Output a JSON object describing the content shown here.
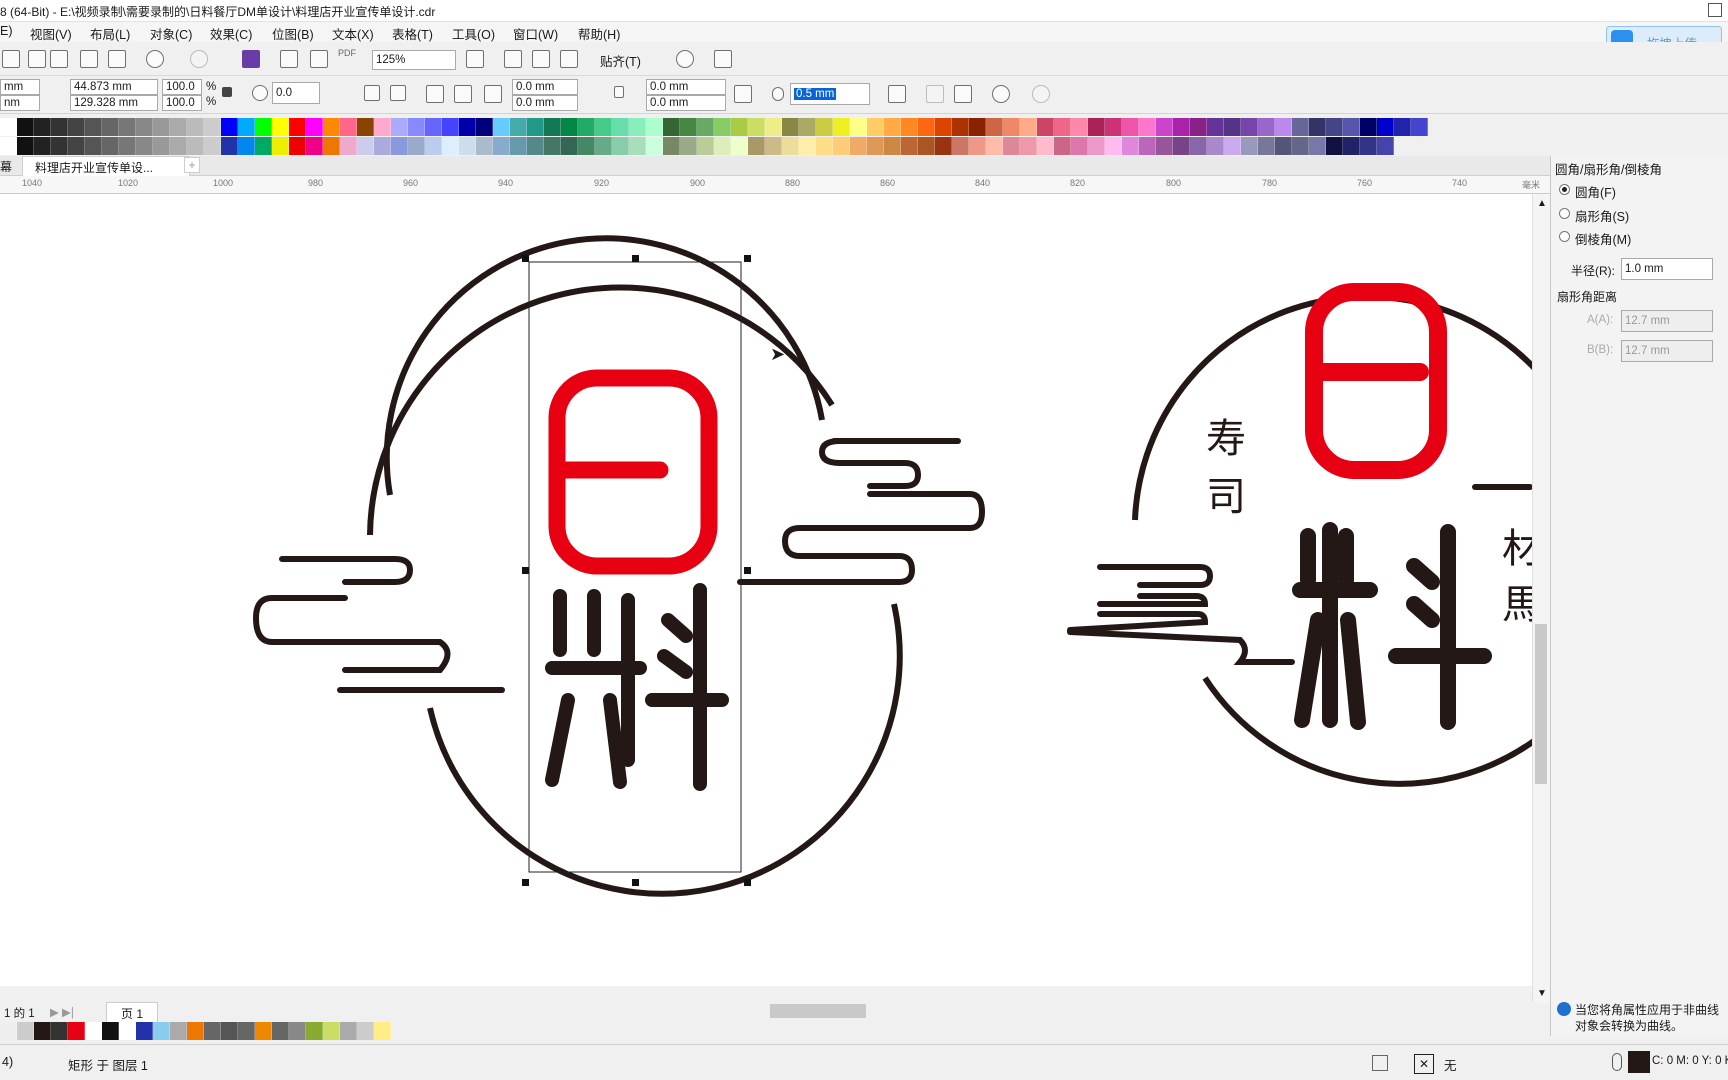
{
  "window": {
    "title": "8 (64-Bit) - E:\\视频录制\\需要录制的\\日料餐厅DM单设计\\料理店开业宣传单设计.cdr",
    "upload_button": "拖拽上传"
  },
  "menu": [
    "E)",
    "视图(V)",
    "布局(L)",
    "对象(C)",
    "效果(C)",
    "位图(B)",
    "文本(X)",
    "表格(T)",
    "工具(O)",
    "窗口(W)",
    "帮助(H)"
  ],
  "toolbar1": {
    "zoom": "125%",
    "snap_label": "贴齐(T)",
    "pdf_label": "PDF"
  },
  "toolbar2": {
    "pos_x": "mm",
    "pos_y": "nm",
    "width": "44.873 mm",
    "height": "129.328 mm",
    "scale_w": "100.0",
    "scale_h": "100.0",
    "pct": "%",
    "rotation": "0.0",
    "corner1": "0.0 mm",
    "corner2": "0.0 mm",
    "corner3": "0.0 mm",
    "corner4": "0.0 mm",
    "outline_width": "0.5 mm"
  },
  "tabs": {
    "first": "幕",
    "document": "料理店开业宣传单设...",
    "add": "+"
  },
  "ruler": {
    "ticks": [
      "1040",
      "1020",
      "1000",
      "980",
      "960",
      "940",
      "920",
      "900",
      "880",
      "860",
      "840",
      "820",
      "800",
      "780",
      "760",
      "740"
    ],
    "unit": "毫米"
  },
  "canvas": {
    "logo_char_main": "料",
    "logo_side_top": "寿",
    "logo_side_bottom": "司",
    "logo_right_top": "材",
    "logo_right_bottom": "馬"
  },
  "docker": {
    "title": "圆角/扇形角/倒棱角",
    "options": [
      "圆角(F)",
      "扇形角(S)",
      "倒棱角(M)"
    ],
    "selected": "圆角(F)",
    "radius_label": "半径(R):",
    "radius_value": "1.0 mm",
    "scallop_label": "扇形角距离",
    "field_a_label": "A(A):",
    "field_a_value": "12.7 mm",
    "field_b_label": "B(B):",
    "field_b_value": "12.7 mm",
    "info_text_1": "当您将角属性应用于非曲线",
    "info_text_2": "对象会转换为曲线。"
  },
  "page_nav": {
    "page_count": "1 的 1",
    "page_tab": "页 1"
  },
  "status": {
    "left": "4)",
    "object_info": "矩形 于 图层 1",
    "fill": "无",
    "color_info": "C: 0 M: 0 Y: 0 K"
  },
  "colors": {
    "logo_red": "#e60012",
    "logo_black": "#231815",
    "accent": "#2d8ff0"
  }
}
